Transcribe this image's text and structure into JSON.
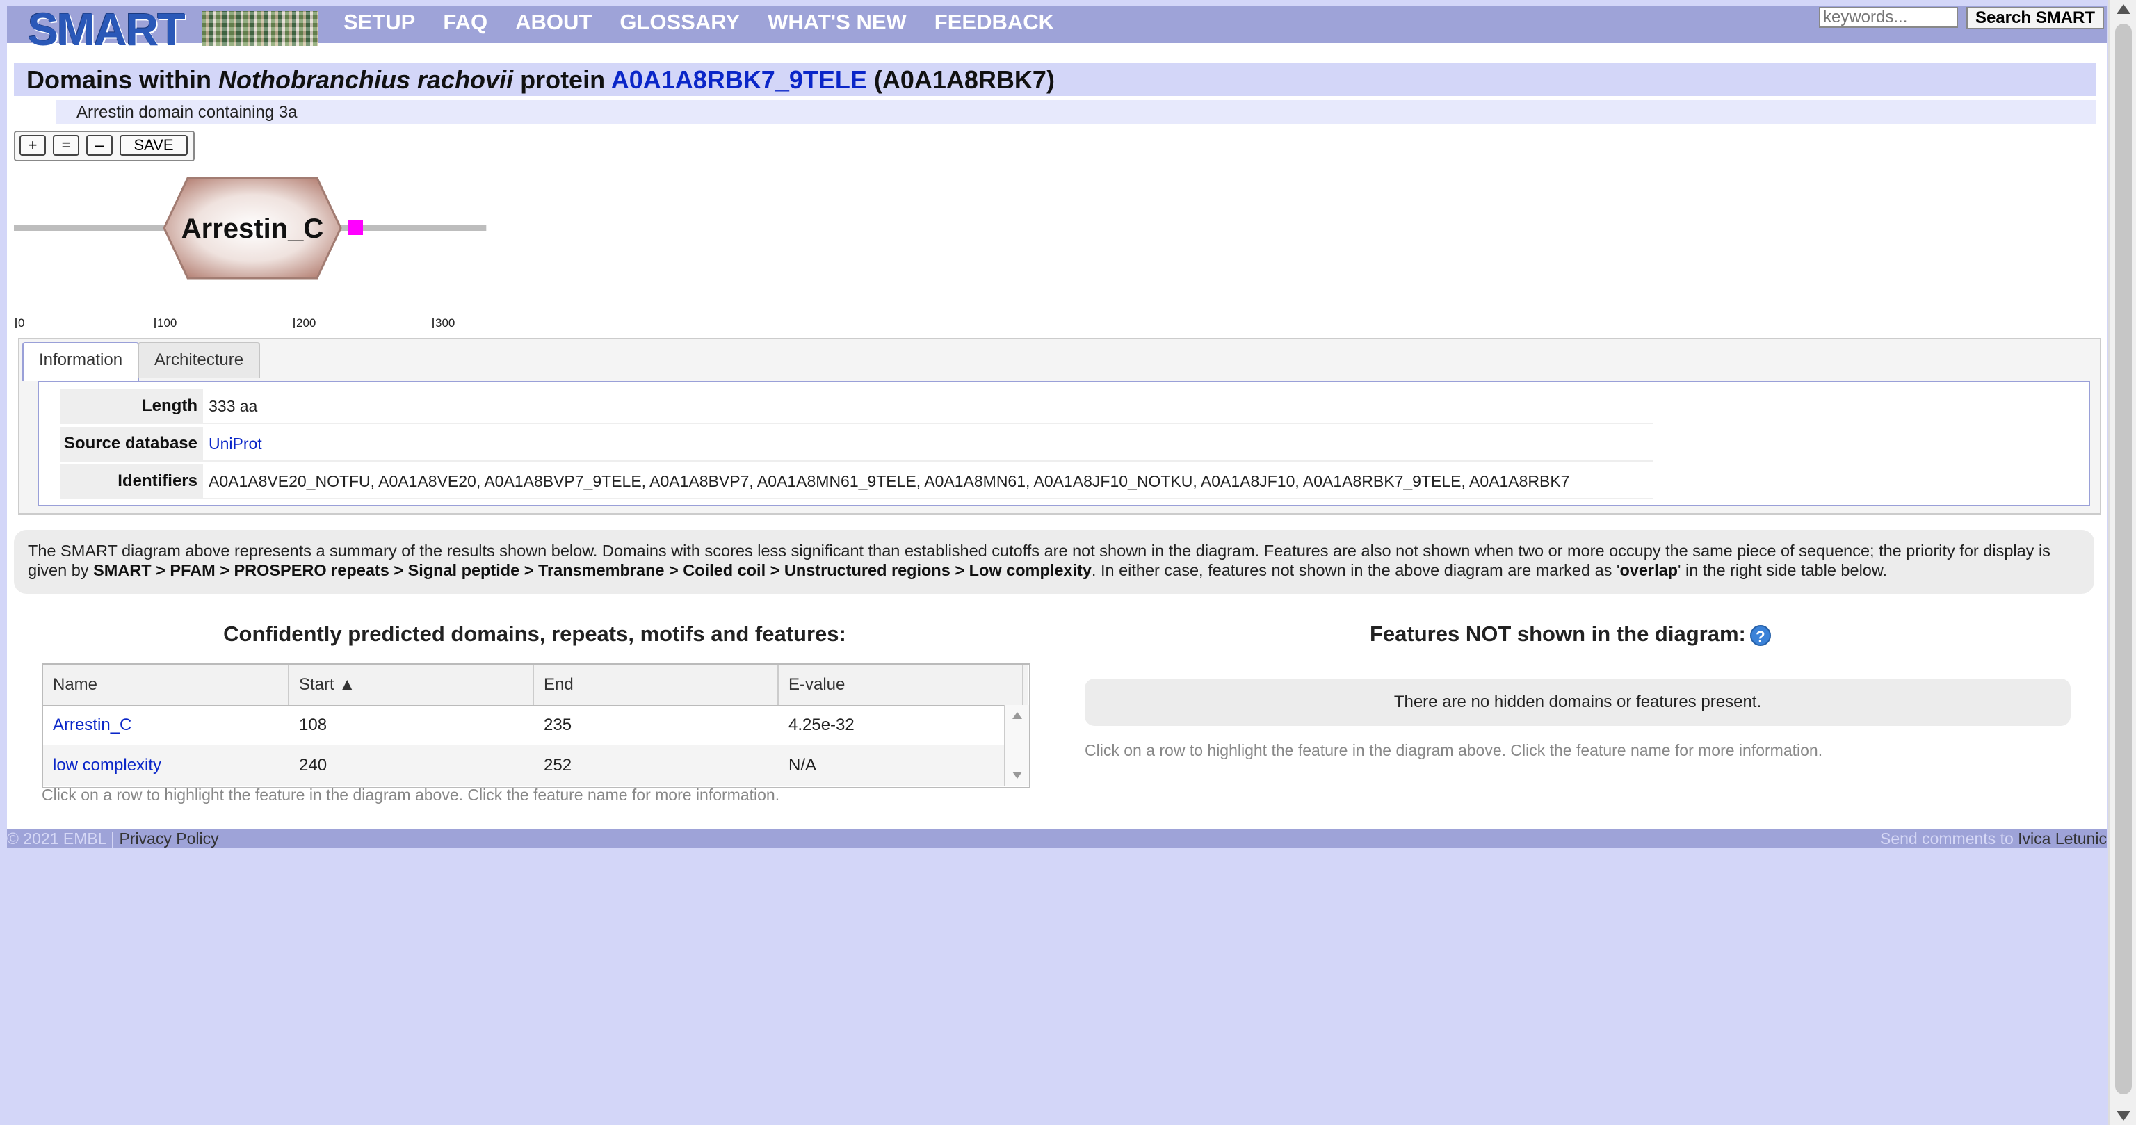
{
  "brand": {
    "logo_text": "SMART"
  },
  "nav": {
    "items": [
      "SETUP",
      "FAQ",
      "ABOUT",
      "GLOSSARY",
      "WHAT'S NEW",
      "FEEDBACK"
    ]
  },
  "search": {
    "placeholder": "keywords...",
    "button_label": "Search SMART"
  },
  "header": {
    "prefix": "Domains within ",
    "species": "Nothobranchius rachovii",
    "mid": " protein ",
    "protein_link": "A0A1A8RBK7_9TELE",
    "accession": " (A0A1A8RBK7)",
    "description": "Arrestin domain containing 3a"
  },
  "zoom": {
    "plus": "+",
    "equal": "=",
    "minus": "–",
    "save": "SAVE"
  },
  "diagram": {
    "protein_length": 333,
    "domain_label": "Arrestin_C",
    "domain_start": 108,
    "domain_end": 235,
    "lowcomplexity_start": 240,
    "lowcomplexity_end": 252,
    "ticks": [
      "0",
      "100",
      "200",
      "300"
    ],
    "colors": {
      "domain": "#c9a39a",
      "low_complexity": "#ff00ff",
      "backbone": "#bdbdbd"
    }
  },
  "tabs": {
    "information": "Information",
    "architecture": "Architecture"
  },
  "info": {
    "length_label": "Length",
    "length_value": "333 aa",
    "source_label": "Source database",
    "source_value": "UniProt",
    "identifiers_label": "Identifiers",
    "identifiers_value": "A0A1A8VE20_NOTFU, A0A1A8VE20, A0A1A8BVP7_9TELE, A0A1A8BVP7, A0A1A8MN61_9TELE, A0A1A8MN61, A0A1A8JF10_NOTKU, A0A1A8JF10, A0A1A8RBK7_9TELE, A0A1A8RBK7"
  },
  "explain": {
    "text1": "The SMART diagram above represents a summary of the results shown below. Domains with scores less significant than established cutoffs are not shown in the diagram. Features are also not shown when two or more occupy the same piece of sequence; the priority for display is given by ",
    "priority": "SMART > PFAM > PROSPERO repeats > Signal peptide > Transmembrane > Coiled coil > Unstructured regions > Low complexity",
    "text2": ". In either case, features not shown in the above diagram are marked as '",
    "overlap": "overlap",
    "text3": "' in the right side table below."
  },
  "left_section": {
    "title": "Confidently predicted domains, repeats, motifs and features:",
    "columns": [
      "Name",
      "Start ▲",
      "End",
      "E-value"
    ],
    "rows": [
      {
        "name": "Arrestin_C",
        "start": "108",
        "end": "235",
        "evalue": "4.25e-32"
      },
      {
        "name": "low complexity",
        "start": "240",
        "end": "252",
        "evalue": "N/A"
      }
    ],
    "hint": "Click on a row to highlight the feature in the diagram above. Click the feature name for more information."
  },
  "right_section": {
    "title": "Features NOT shown in the diagram:",
    "help_icon": "question-mark",
    "empty_message": "There are no hidden domains or features present.",
    "hint": "Click on a row to highlight the feature in the diagram above. Click the feature name for more information."
  },
  "footer": {
    "copyright": "© 2021 EMBL | ",
    "privacy": "Privacy Policy",
    "comments_prefix": "Send comments to ",
    "contact": "Ivica Letunic"
  }
}
